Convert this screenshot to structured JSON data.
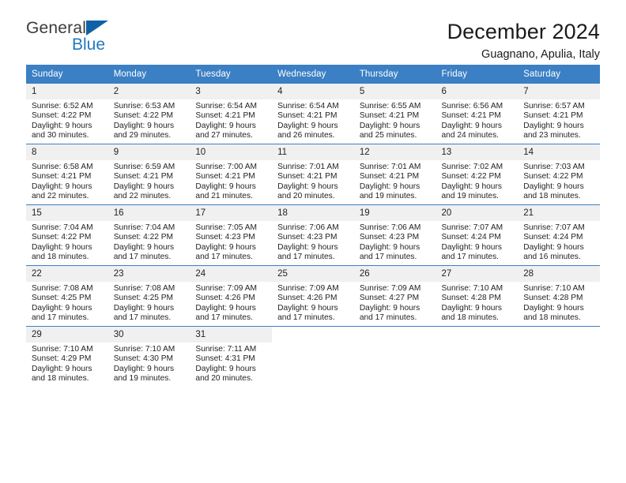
{
  "brand": {
    "name_primary": "General",
    "name_secondary": "Blue",
    "triangle_color": "#1060a8",
    "secondary_color": "#1f7ac0"
  },
  "header": {
    "title": "December 2024",
    "subtitle": "Guagnano, Apulia, Italy"
  },
  "theme": {
    "header_bar_color": "#3b7fc4",
    "daynum_band_color": "#f0f0f0",
    "row_divider_color": "#3b7fc4"
  },
  "weekdays": [
    "Sunday",
    "Monday",
    "Tuesday",
    "Wednesday",
    "Thursday",
    "Friday",
    "Saturday"
  ],
  "weeks": [
    [
      {
        "day": "1",
        "sunrise": "Sunrise: 6:52 AM",
        "sunset": "Sunset: 4:22 PM",
        "daylight_line1": "Daylight: 9 hours",
        "daylight_line2": "and 30 minutes."
      },
      {
        "day": "2",
        "sunrise": "Sunrise: 6:53 AM",
        "sunset": "Sunset: 4:22 PM",
        "daylight_line1": "Daylight: 9 hours",
        "daylight_line2": "and 29 minutes."
      },
      {
        "day": "3",
        "sunrise": "Sunrise: 6:54 AM",
        "sunset": "Sunset: 4:21 PM",
        "daylight_line1": "Daylight: 9 hours",
        "daylight_line2": "and 27 minutes."
      },
      {
        "day": "4",
        "sunrise": "Sunrise: 6:54 AM",
        "sunset": "Sunset: 4:21 PM",
        "daylight_line1": "Daylight: 9 hours",
        "daylight_line2": "and 26 minutes."
      },
      {
        "day": "5",
        "sunrise": "Sunrise: 6:55 AM",
        "sunset": "Sunset: 4:21 PM",
        "daylight_line1": "Daylight: 9 hours",
        "daylight_line2": "and 25 minutes."
      },
      {
        "day": "6",
        "sunrise": "Sunrise: 6:56 AM",
        "sunset": "Sunset: 4:21 PM",
        "daylight_line1": "Daylight: 9 hours",
        "daylight_line2": "and 24 minutes."
      },
      {
        "day": "7",
        "sunrise": "Sunrise: 6:57 AM",
        "sunset": "Sunset: 4:21 PM",
        "daylight_line1": "Daylight: 9 hours",
        "daylight_line2": "and 23 minutes."
      }
    ],
    [
      {
        "day": "8",
        "sunrise": "Sunrise: 6:58 AM",
        "sunset": "Sunset: 4:21 PM",
        "daylight_line1": "Daylight: 9 hours",
        "daylight_line2": "and 22 minutes."
      },
      {
        "day": "9",
        "sunrise": "Sunrise: 6:59 AM",
        "sunset": "Sunset: 4:21 PM",
        "daylight_line1": "Daylight: 9 hours",
        "daylight_line2": "and 22 minutes."
      },
      {
        "day": "10",
        "sunrise": "Sunrise: 7:00 AM",
        "sunset": "Sunset: 4:21 PM",
        "daylight_line1": "Daylight: 9 hours",
        "daylight_line2": "and 21 minutes."
      },
      {
        "day": "11",
        "sunrise": "Sunrise: 7:01 AM",
        "sunset": "Sunset: 4:21 PM",
        "daylight_line1": "Daylight: 9 hours",
        "daylight_line2": "and 20 minutes."
      },
      {
        "day": "12",
        "sunrise": "Sunrise: 7:01 AM",
        "sunset": "Sunset: 4:21 PM",
        "daylight_line1": "Daylight: 9 hours",
        "daylight_line2": "and 19 minutes."
      },
      {
        "day": "13",
        "sunrise": "Sunrise: 7:02 AM",
        "sunset": "Sunset: 4:22 PM",
        "daylight_line1": "Daylight: 9 hours",
        "daylight_line2": "and 19 minutes."
      },
      {
        "day": "14",
        "sunrise": "Sunrise: 7:03 AM",
        "sunset": "Sunset: 4:22 PM",
        "daylight_line1": "Daylight: 9 hours",
        "daylight_line2": "and 18 minutes."
      }
    ],
    [
      {
        "day": "15",
        "sunrise": "Sunrise: 7:04 AM",
        "sunset": "Sunset: 4:22 PM",
        "daylight_line1": "Daylight: 9 hours",
        "daylight_line2": "and 18 minutes."
      },
      {
        "day": "16",
        "sunrise": "Sunrise: 7:04 AM",
        "sunset": "Sunset: 4:22 PM",
        "daylight_line1": "Daylight: 9 hours",
        "daylight_line2": "and 17 minutes."
      },
      {
        "day": "17",
        "sunrise": "Sunrise: 7:05 AM",
        "sunset": "Sunset: 4:23 PM",
        "daylight_line1": "Daylight: 9 hours",
        "daylight_line2": "and 17 minutes."
      },
      {
        "day": "18",
        "sunrise": "Sunrise: 7:06 AM",
        "sunset": "Sunset: 4:23 PM",
        "daylight_line1": "Daylight: 9 hours",
        "daylight_line2": "and 17 minutes."
      },
      {
        "day": "19",
        "sunrise": "Sunrise: 7:06 AM",
        "sunset": "Sunset: 4:23 PM",
        "daylight_line1": "Daylight: 9 hours",
        "daylight_line2": "and 17 minutes."
      },
      {
        "day": "20",
        "sunrise": "Sunrise: 7:07 AM",
        "sunset": "Sunset: 4:24 PM",
        "daylight_line1": "Daylight: 9 hours",
        "daylight_line2": "and 17 minutes."
      },
      {
        "day": "21",
        "sunrise": "Sunrise: 7:07 AM",
        "sunset": "Sunset: 4:24 PM",
        "daylight_line1": "Daylight: 9 hours",
        "daylight_line2": "and 16 minutes."
      }
    ],
    [
      {
        "day": "22",
        "sunrise": "Sunrise: 7:08 AM",
        "sunset": "Sunset: 4:25 PM",
        "daylight_line1": "Daylight: 9 hours",
        "daylight_line2": "and 17 minutes."
      },
      {
        "day": "23",
        "sunrise": "Sunrise: 7:08 AM",
        "sunset": "Sunset: 4:25 PM",
        "daylight_line1": "Daylight: 9 hours",
        "daylight_line2": "and 17 minutes."
      },
      {
        "day": "24",
        "sunrise": "Sunrise: 7:09 AM",
        "sunset": "Sunset: 4:26 PM",
        "daylight_line1": "Daylight: 9 hours",
        "daylight_line2": "and 17 minutes."
      },
      {
        "day": "25",
        "sunrise": "Sunrise: 7:09 AM",
        "sunset": "Sunset: 4:26 PM",
        "daylight_line1": "Daylight: 9 hours",
        "daylight_line2": "and 17 minutes."
      },
      {
        "day": "26",
        "sunrise": "Sunrise: 7:09 AM",
        "sunset": "Sunset: 4:27 PM",
        "daylight_line1": "Daylight: 9 hours",
        "daylight_line2": "and 17 minutes."
      },
      {
        "day": "27",
        "sunrise": "Sunrise: 7:10 AM",
        "sunset": "Sunset: 4:28 PM",
        "daylight_line1": "Daylight: 9 hours",
        "daylight_line2": "and 18 minutes."
      },
      {
        "day": "28",
        "sunrise": "Sunrise: 7:10 AM",
        "sunset": "Sunset: 4:28 PM",
        "daylight_line1": "Daylight: 9 hours",
        "daylight_line2": "and 18 minutes."
      }
    ],
    [
      {
        "day": "29",
        "sunrise": "Sunrise: 7:10 AM",
        "sunset": "Sunset: 4:29 PM",
        "daylight_line1": "Daylight: 9 hours",
        "daylight_line2": "and 18 minutes."
      },
      {
        "day": "30",
        "sunrise": "Sunrise: 7:10 AM",
        "sunset": "Sunset: 4:30 PM",
        "daylight_line1": "Daylight: 9 hours",
        "daylight_line2": "and 19 minutes."
      },
      {
        "day": "31",
        "sunrise": "Sunrise: 7:11 AM",
        "sunset": "Sunset: 4:31 PM",
        "daylight_line1": "Daylight: 9 hours",
        "daylight_line2": "and 20 minutes."
      },
      {
        "day": "",
        "sunrise": "",
        "sunset": "",
        "daylight_line1": "",
        "daylight_line2": ""
      },
      {
        "day": "",
        "sunrise": "",
        "sunset": "",
        "daylight_line1": "",
        "daylight_line2": ""
      },
      {
        "day": "",
        "sunrise": "",
        "sunset": "",
        "daylight_line1": "",
        "daylight_line2": ""
      },
      {
        "day": "",
        "sunrise": "",
        "sunset": "",
        "daylight_line1": "",
        "daylight_line2": ""
      }
    ]
  ]
}
